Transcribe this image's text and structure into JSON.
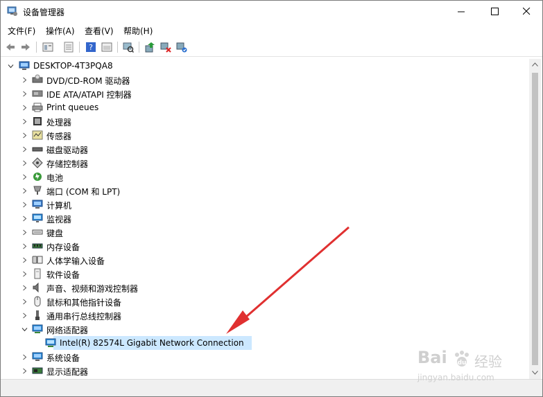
{
  "window": {
    "title": "设备管理器"
  },
  "menu": [
    "文件(F)",
    "操作(A)",
    "查看(V)",
    "帮助(H)"
  ],
  "toolbar": {
    "buttons": [
      "back-icon",
      "forward-icon",
      "properties-icon",
      "list-icon",
      "help-icon",
      "show-icon",
      "scan-icon",
      "update-driver-icon",
      "uninstall-icon",
      "enable-icon"
    ]
  },
  "tree": {
    "root": "DESKTOP-4T3PQA8",
    "items": [
      {
        "label": "DVD/CD-ROM 驱动器",
        "icon": "dvd-drive-icon"
      },
      {
        "label": "IDE ATA/ATAPI 控制器",
        "icon": "ide-controller-icon"
      },
      {
        "label": "Print queues",
        "icon": "printer-icon"
      },
      {
        "label": "处理器",
        "icon": "processor-icon"
      },
      {
        "label": "传感器",
        "icon": "sensor-icon"
      },
      {
        "label": "磁盘驱动器",
        "icon": "disk-drive-icon"
      },
      {
        "label": "存储控制器",
        "icon": "storage-controller-icon"
      },
      {
        "label": "电池",
        "icon": "battery-icon"
      },
      {
        "label": "端口 (COM 和 LPT)",
        "icon": "port-icon"
      },
      {
        "label": "计算机",
        "icon": "computer-icon"
      },
      {
        "label": "监视器",
        "icon": "monitor-icon"
      },
      {
        "label": "键盘",
        "icon": "keyboard-icon"
      },
      {
        "label": "内存设备",
        "icon": "memory-icon"
      },
      {
        "label": "人体学输入设备",
        "icon": "hid-icon"
      },
      {
        "label": "软件设备",
        "icon": "software-device-icon"
      },
      {
        "label": "声音、视频和游戏控制器",
        "icon": "sound-icon"
      },
      {
        "label": "鼠标和其他指针设备",
        "icon": "mouse-icon"
      },
      {
        "label": "通用串行总线控制器",
        "icon": "usb-icon"
      },
      {
        "label": "网络适配器",
        "icon": "network-adapter-icon",
        "expanded": true
      },
      {
        "label": "Intel(R) 82574L Gigabit Network Connection",
        "icon": "network-card-icon",
        "child": true,
        "selected": true
      },
      {
        "label": "系统设备",
        "icon": "system-device-icon"
      },
      {
        "label": "显示适配器",
        "icon": "display-adapter-icon"
      }
    ]
  },
  "watermark": {
    "brand": "Bai",
    "brand2": "经验",
    "url": "jingyan.baidu.com"
  },
  "colors": {
    "selection": "#cce8ff",
    "arrow": "#e03030",
    "accent": "#0078d7"
  }
}
